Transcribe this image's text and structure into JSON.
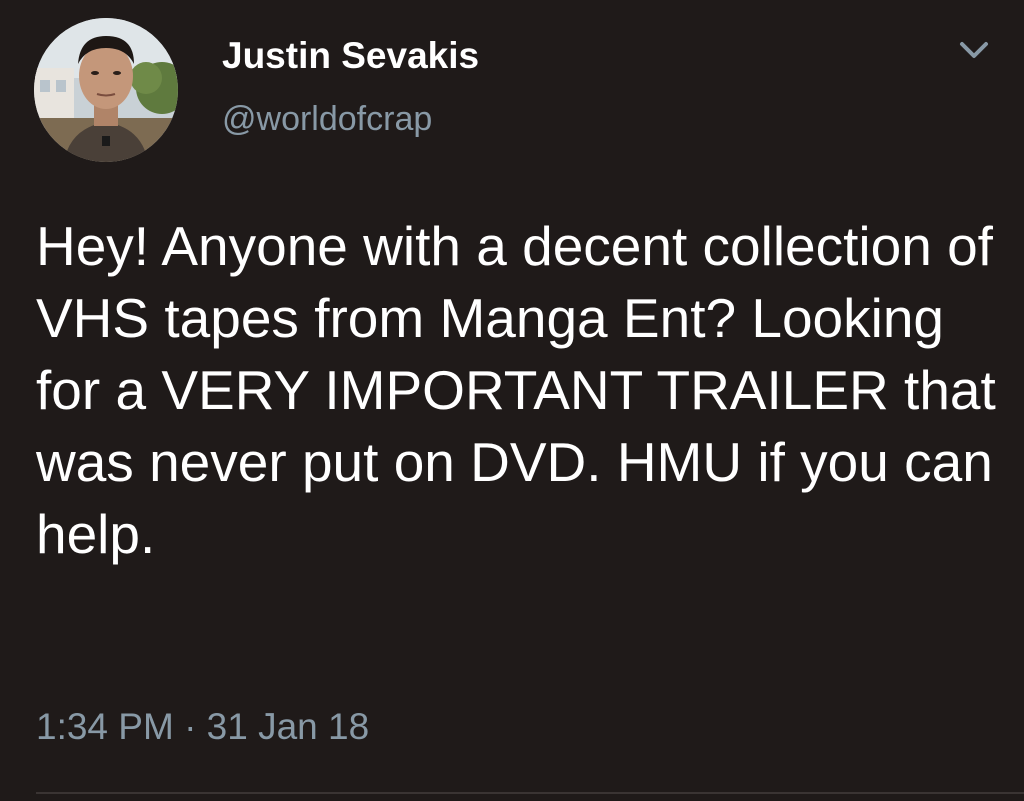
{
  "tweet": {
    "display_name": "Justin Sevakis",
    "handle": "@worldofcrap",
    "text": "Hey! Anyone with a decent collection of VHS tapes from Manga Ent? Looking for a VERY IMPORTANT TRAILER that was never put on DVD. HMU if you can help.",
    "timestamp": "1:34 PM · 31 Jan 18"
  },
  "icons": {
    "caret": "chevron-down-icon",
    "avatar": "avatar"
  },
  "colors": {
    "background": "#1f1a19",
    "primary_text": "#ffffff",
    "secondary_text": "#8899a6",
    "divider": "#3a3433"
  }
}
